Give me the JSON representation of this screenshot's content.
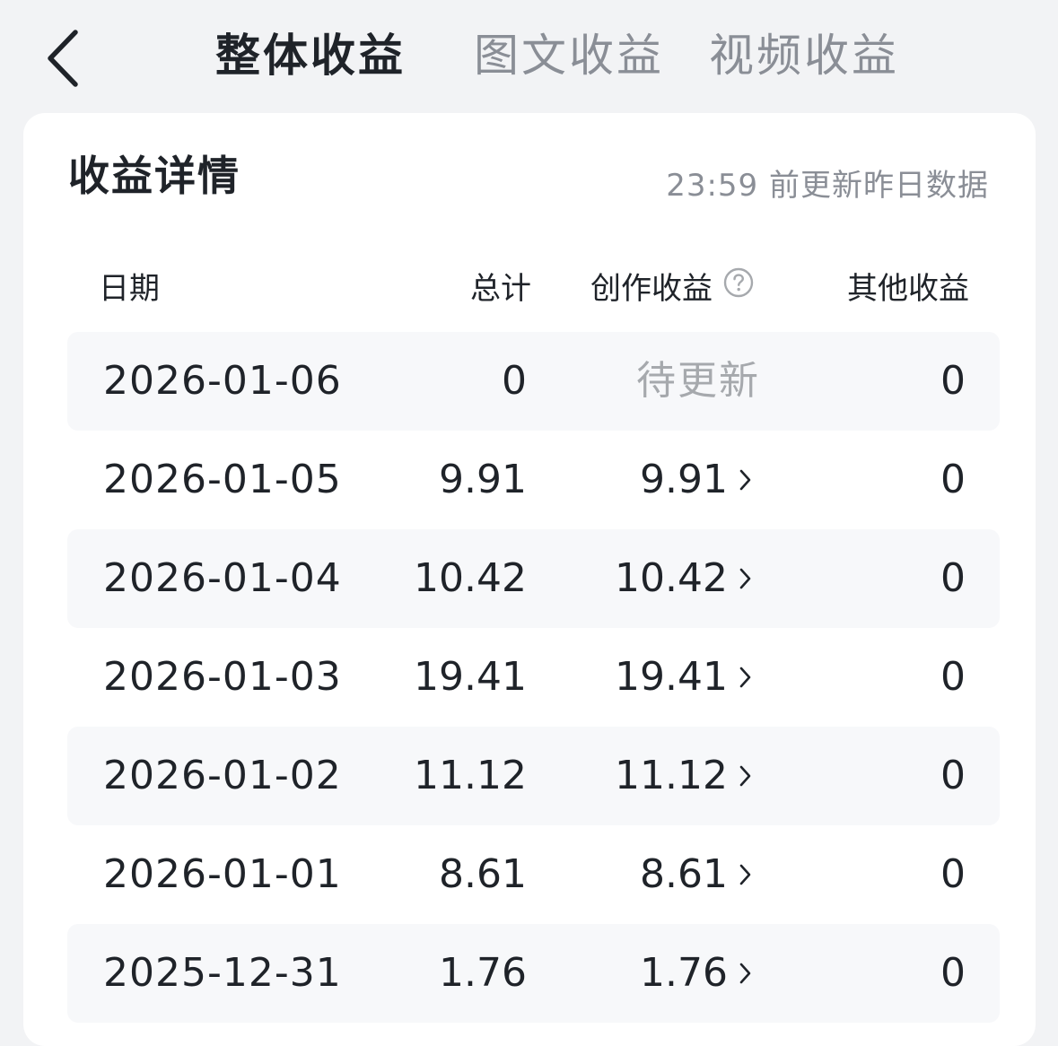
{
  "nav": {
    "back_label": "",
    "tabs": [
      {
        "label": "整体收益",
        "active": true
      },
      {
        "label": "图文收益",
        "active": false
      },
      {
        "label": "视频收益",
        "active": false
      }
    ]
  },
  "card": {
    "title": "收益详情",
    "update_note": "23:59 前更新昨日数据"
  },
  "table": {
    "headers": {
      "date": "日期",
      "total": "总计",
      "creation": "创作收益",
      "other": "其他收益"
    },
    "rows": [
      {
        "date": "2026-01-06",
        "total": "0",
        "creation": "待更新",
        "other": "0"
      },
      {
        "date": "2026-01-05",
        "total": "9.91",
        "creation": "9.91",
        "other": "0"
      },
      {
        "date": "2026-01-04",
        "total": "10.42",
        "creation": "10.42",
        "other": "0"
      },
      {
        "date": "2026-01-03",
        "total": "19.41",
        "creation": "19.41",
        "other": "0"
      },
      {
        "date": "2026-01-02",
        "total": "11.12",
        "creation": "11.12",
        "other": "0"
      },
      {
        "date": "2026-01-01",
        "total": "8.61",
        "creation": "8.61",
        "other": "0"
      },
      {
        "date": "2025-12-31",
        "total": "1.76",
        "creation": "1.76",
        "other": "0"
      }
    ]
  },
  "colors": {
    "page_bg": "#f2f3f5",
    "card_bg": "#ffffff",
    "row_shade": "#f7f8fa",
    "text_primary": "#1f2329",
    "text_secondary": "#8a8e96",
    "text_pending": "#a6a9ad"
  },
  "icons": {
    "back": "chevron-left-icon",
    "help": "question-circle-icon",
    "detail": "chevron-right-icon"
  }
}
